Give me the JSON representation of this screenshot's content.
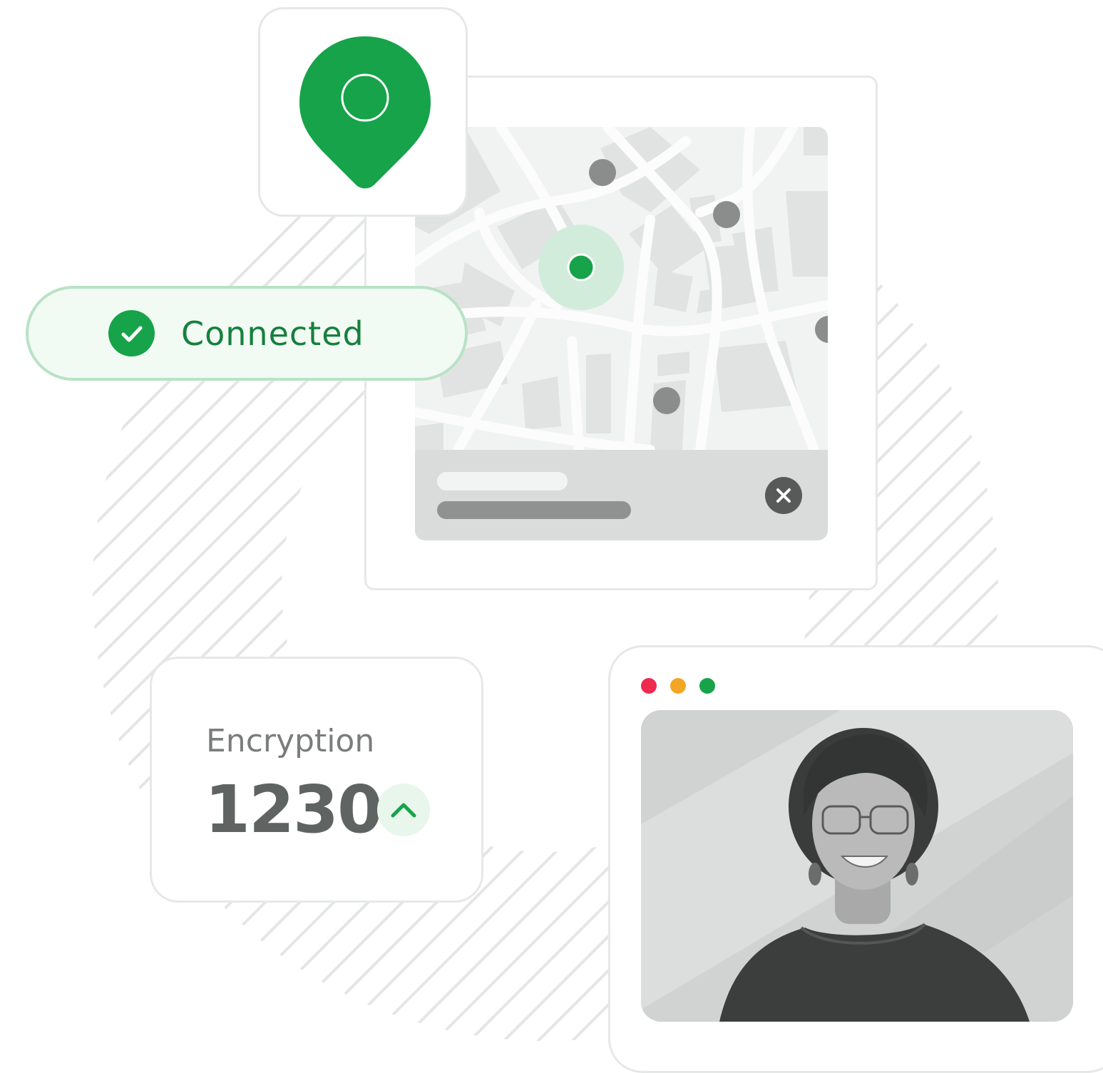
{
  "connection": {
    "status_label": "Connected",
    "accent_color": "#16a34a"
  },
  "encryption": {
    "label": "Encryption",
    "value": "1230",
    "trend": "up"
  },
  "map": {
    "pin_icon": "location-pin-icon",
    "close_icon": "close-icon"
  },
  "window": {
    "controls": [
      {
        "name": "close",
        "color": "#ef2a4f"
      },
      {
        "name": "minimize",
        "color": "#f5a524"
      },
      {
        "name": "maximize",
        "color": "#16a34a"
      }
    ],
    "photo_alt": "profile-photo"
  }
}
